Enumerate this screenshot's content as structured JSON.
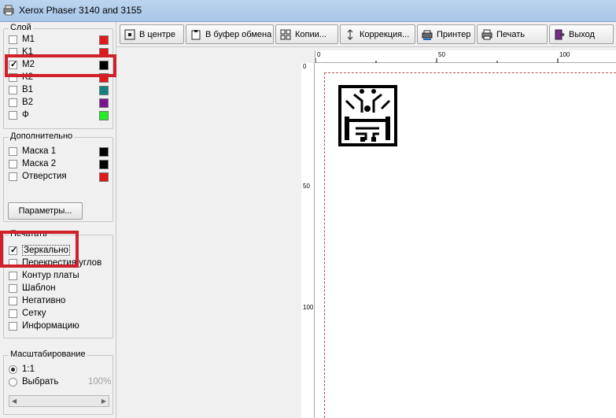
{
  "window": {
    "title": "Xerox Phaser 3140 and 3155"
  },
  "layers": {
    "legend": "Слой",
    "items": [
      {
        "label": "M1",
        "checked": false,
        "color": "#e11919"
      },
      {
        "label": "K1",
        "checked": false,
        "color": "#e11919"
      },
      {
        "label": "M2",
        "checked": true,
        "color": "#000000"
      },
      {
        "label": "K2",
        "checked": false,
        "color": "#e11919"
      },
      {
        "label": "B1",
        "checked": false,
        "color": "#128080"
      },
      {
        "label": "B2",
        "checked": false,
        "color": "#7a1490"
      },
      {
        "label": "Ф",
        "checked": false,
        "color": "#22ee22"
      }
    ]
  },
  "additional": {
    "legend": "Дополнительно",
    "items": [
      {
        "label": "Маска 1",
        "checked": false,
        "color": "#000000"
      },
      {
        "label": "Маска 2",
        "checked": false,
        "color": "#000000"
      },
      {
        "label": "Отверстия",
        "checked": false,
        "color": "#e11919"
      }
    ],
    "params_button": "Параметры..."
  },
  "print": {
    "legend": "Печатать",
    "items": [
      {
        "label": "Зеркально",
        "checked": true
      },
      {
        "label": "Перекрестия углов",
        "checked": false
      },
      {
        "label": "Контур платы",
        "checked": false
      },
      {
        "label": "Шаблон",
        "checked": false
      },
      {
        "label": "Негативно",
        "checked": false
      },
      {
        "label": "Сетку",
        "checked": false
      },
      {
        "label": "Информацию",
        "checked": false
      }
    ]
  },
  "scale": {
    "legend": "Масштабирование",
    "option_1": "1:1",
    "option_2": "Выбрать",
    "percent": "100%",
    "selected": "1:1"
  },
  "toolbar": {
    "center": "В центре",
    "clipboard": "В буфер обмена",
    "copies": "Копии...",
    "correction": "Коррекция...",
    "printer": "Принтер",
    "print": "Печать",
    "exit": "Выход"
  },
  "rulers": {
    "top": [
      "0",
      "50",
      "100"
    ],
    "left": [
      "0",
      "50",
      "100"
    ]
  },
  "colors": {
    "highlight": "#d0202a",
    "margin_line": "#b84a4a"
  }
}
